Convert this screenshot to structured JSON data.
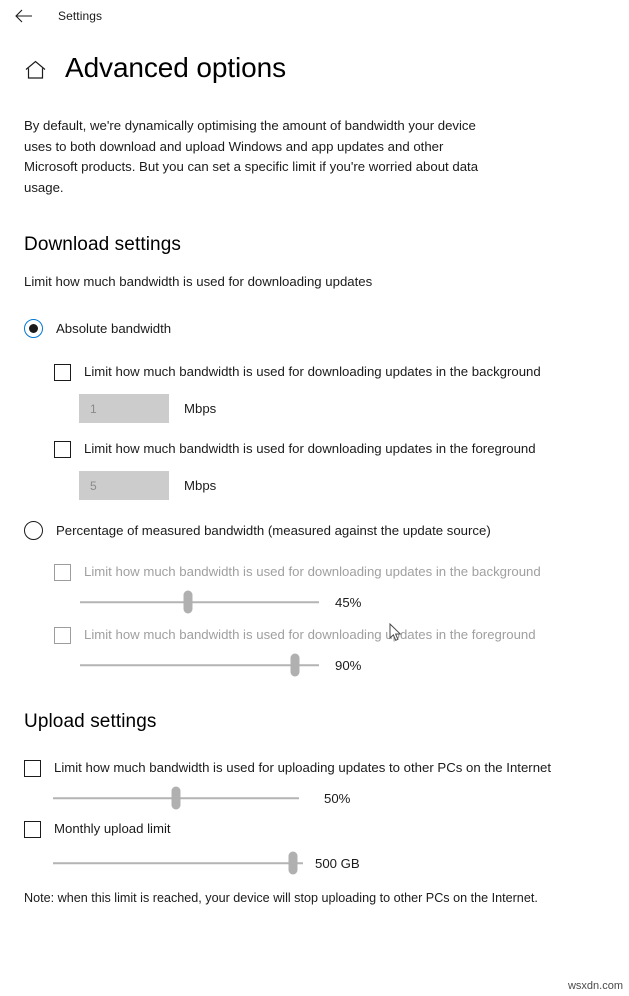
{
  "titlebar": {
    "back_icon": "back-arrow-icon",
    "app_name": "Settings"
  },
  "header": {
    "home_icon": "home-icon",
    "title": "Advanced options"
  },
  "intro": "By default, we're dynamically optimising the amount of bandwidth your device uses to both download and upload Windows and app updates and other Microsoft products. But you can set a specific limit if you're worried about data usage.",
  "download": {
    "section_title": "Download settings",
    "subtitle": "Limit how much bandwidth is used for downloading updates",
    "absolute": {
      "radio_label": "Absolute bandwidth",
      "selected": true,
      "background": {
        "checkbox_label": "Limit how much bandwidth is used for downloading updates in the background",
        "checked": false,
        "value": "1",
        "unit": "Mbps"
      },
      "foreground": {
        "checkbox_label": "Limit how much bandwidth is used for downloading updates in the foreground",
        "checked": false,
        "value": "5",
        "unit": "Mbps"
      }
    },
    "percentage": {
      "radio_label": "Percentage of measured bandwidth (measured against the update source)",
      "selected": false,
      "background": {
        "checkbox_label": "Limit how much bandwidth is used for downloading updates in the background",
        "checked": false,
        "slider_value": "45%",
        "slider_percent": 45
      },
      "foreground": {
        "checkbox_label": "Limit how much bandwidth is used for downloading updates in the foreground",
        "checked": false,
        "slider_value": "90%",
        "slider_percent": 90
      }
    }
  },
  "upload": {
    "section_title": "Upload settings",
    "limit_bandwidth": {
      "checkbox_label": "Limit how much bandwidth is used for uploading updates to other PCs on the Internet",
      "checked": false,
      "slider_value": "50%",
      "slider_percent": 50
    },
    "monthly_limit": {
      "checkbox_label": "Monthly upload limit",
      "checked": false,
      "slider_value": "500 GB",
      "slider_percent": 96
    },
    "note": "Note: when this limit is reached, your device will stop uploading to other PCs on the Internet."
  },
  "watermark": "wsxdn.com",
  "colors": {
    "accent": "#0078d7",
    "text": "#1b1b1b",
    "disabled_text": "#a0a0a0",
    "field_bg": "#cccccc",
    "slider_track": "#b4b4b4",
    "slider_thumb": "#b0b0b0"
  }
}
